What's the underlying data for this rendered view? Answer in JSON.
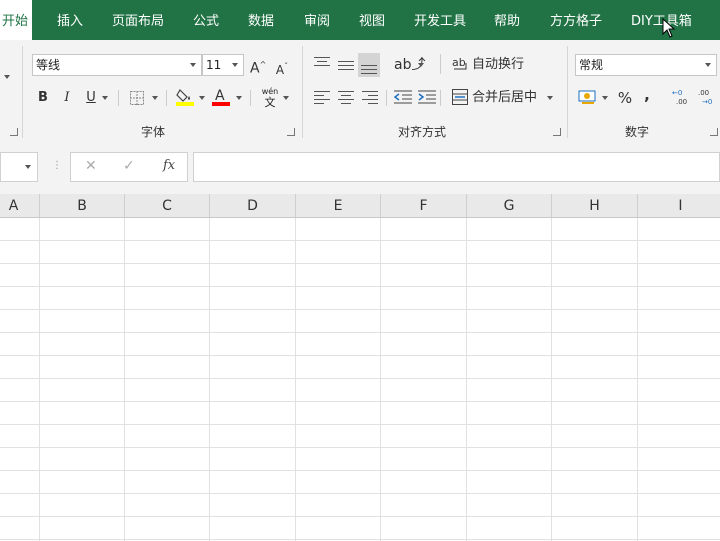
{
  "ribbon_tabs": [
    {
      "label": "开始",
      "active": true
    },
    {
      "label": "插入"
    },
    {
      "label": "页面布局"
    },
    {
      "label": "公式"
    },
    {
      "label": "数据"
    },
    {
      "label": "审阅"
    },
    {
      "label": "视图"
    },
    {
      "label": "开发工具"
    },
    {
      "label": "帮助"
    },
    {
      "label": "方方格子"
    },
    {
      "label": "DIY工具箱"
    }
  ],
  "font_group": {
    "font_name": "等线",
    "font_size": "11",
    "grow_font": "A",
    "shrink_font": "A",
    "bold": "B",
    "italic": "I",
    "underline": "U",
    "phonetic_top": "wén",
    "phonetic_bottom": "文",
    "label": "字体",
    "fill_color": "#ffff00",
    "font_color": "#ff0000"
  },
  "alignment_group": {
    "wrap_text": "自动换行",
    "merge_center": "合并后居中",
    "label": "对齐方式"
  },
  "number_group": {
    "format": "常规",
    "percent": "%",
    "comma": ",",
    "label": "数字"
  },
  "formula_bar": {
    "cancel": "✕",
    "enter": "✓",
    "fx": "fx",
    "value": ""
  },
  "columns": [
    "A",
    "B",
    "C",
    "D",
    "E",
    "F",
    "G",
    "H",
    "I"
  ],
  "accent_color": "#217346"
}
